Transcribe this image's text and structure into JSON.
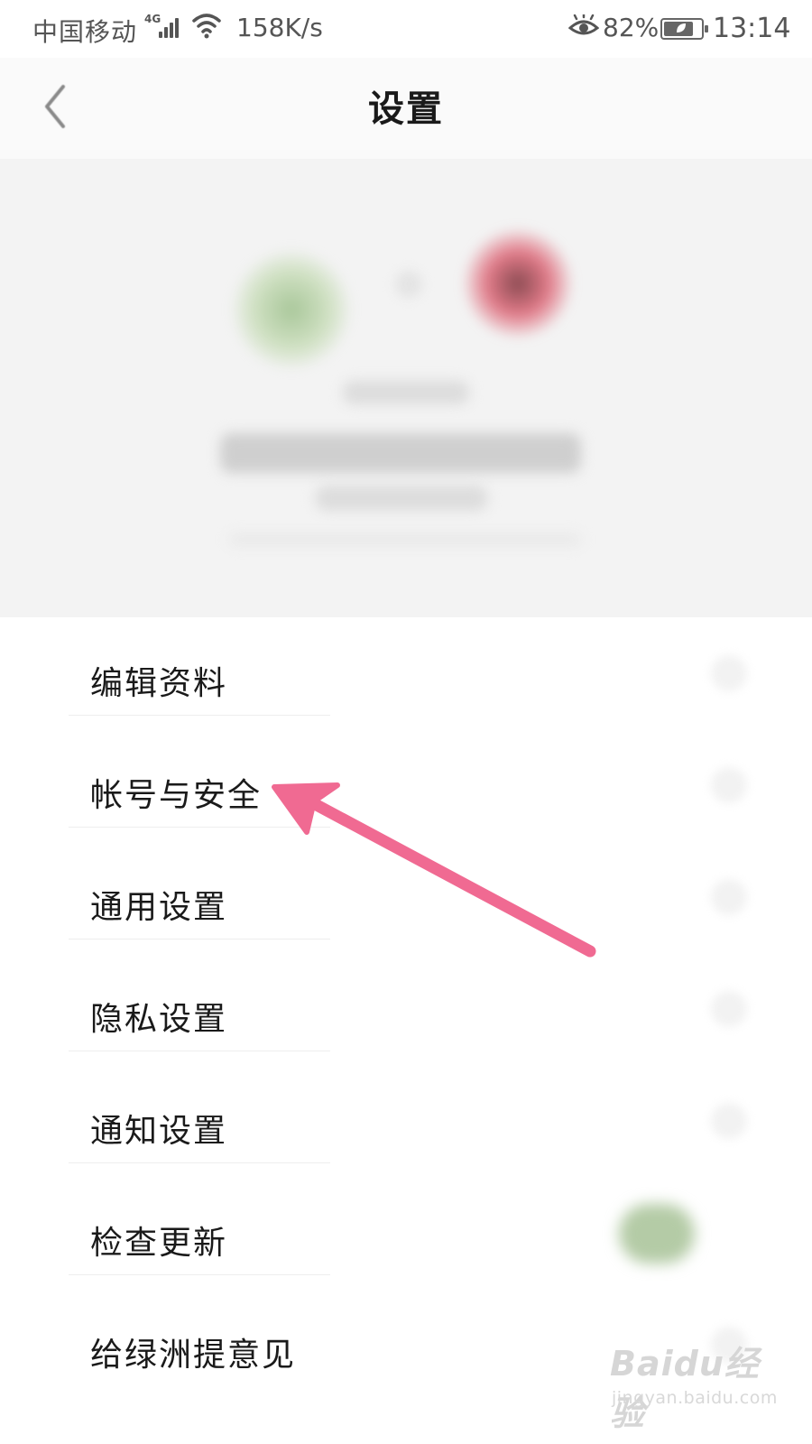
{
  "status_bar": {
    "carrier": "中国移动",
    "network_type": "4G",
    "speed": "158K/s",
    "battery_percent": "82%",
    "battery_level": 0.82,
    "time": "13:14",
    "icons": [
      "signal-icon",
      "wifi-icon",
      "eye-comfort-icon",
      "battery-icon"
    ]
  },
  "header": {
    "title": "设置",
    "back_icon": "chevron-left-icon"
  },
  "menu": {
    "items": [
      {
        "label": "编辑资料"
      },
      {
        "label": "帐号与安全"
      },
      {
        "label": "通用设置"
      },
      {
        "label": "隐私设置"
      },
      {
        "label": "通知设置"
      },
      {
        "label": "检查更新"
      },
      {
        "label": "给绿洲提意见"
      }
    ]
  },
  "annotation": {
    "color": "#f06a92",
    "target": "帐号与安全"
  },
  "watermark": {
    "logo": "Baidu经验",
    "url": "jingyan.baidu.com"
  }
}
